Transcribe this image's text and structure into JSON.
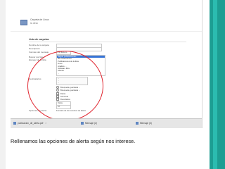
{
  "header": {
    "title": "Carpeta de Linux",
    "subtitle": "la desc"
  },
  "panel": {
    "title": "Lista de carpetas",
    "labels": {
      "nombre": "Nombre de la carpeta",
      "descripcion": "Descripción",
      "formato": "Formato del mensaje",
      "buscar": "Buscar por lista",
      "escoger": "Escoger de la lista",
      "destinatarios": "Destinatarios",
      "opciones": "Opciones de alerta"
    },
    "format_value": "Por defecto",
    "list_items": [
      {
        "text": "Seguir publicaciones...",
        "selected": true
      },
      {
        "text": "Mis colecciones ...",
        "selected": false
      },
      {
        "text": "Publicaciones de la lista",
        "selected": false
      },
      {
        "text": "Linux",
        "selected": false
      },
      {
        "text": "Análisis ...",
        "selected": false
      },
      {
        "text": "Software libre",
        "selected": false
      },
      {
        "text": "Ubuntu",
        "selected": false
      },
      {
        "text": "...",
        "selected": false
      }
    ],
    "filled_lines": [
      "...",
      "...",
      "..."
    ],
    "radio_options": [
      "Búsqueda guardada ...",
      "Búsqueda guardada ..."
    ],
    "extra_options": [
      "Diaria",
      "Semanal",
      "Resultados"
    ],
    "select_small": [
      "Diaria",
      "10"
    ],
    "alert_options_text": "Formato de los recursos de alerta"
  },
  "taskbar": {
    "tasks": [
      "publicacion_de_alerta.pdf",
      "Mensaje (2)",
      "Mensaje (3)"
    ]
  },
  "caption": {
    "text": "Rellenamos las opciones de alerta según nos interese."
  },
  "colors": {
    "accent_bar": "#1d9e93",
    "highlight_circle": "#e02630",
    "selection": "#3875d7"
  }
}
